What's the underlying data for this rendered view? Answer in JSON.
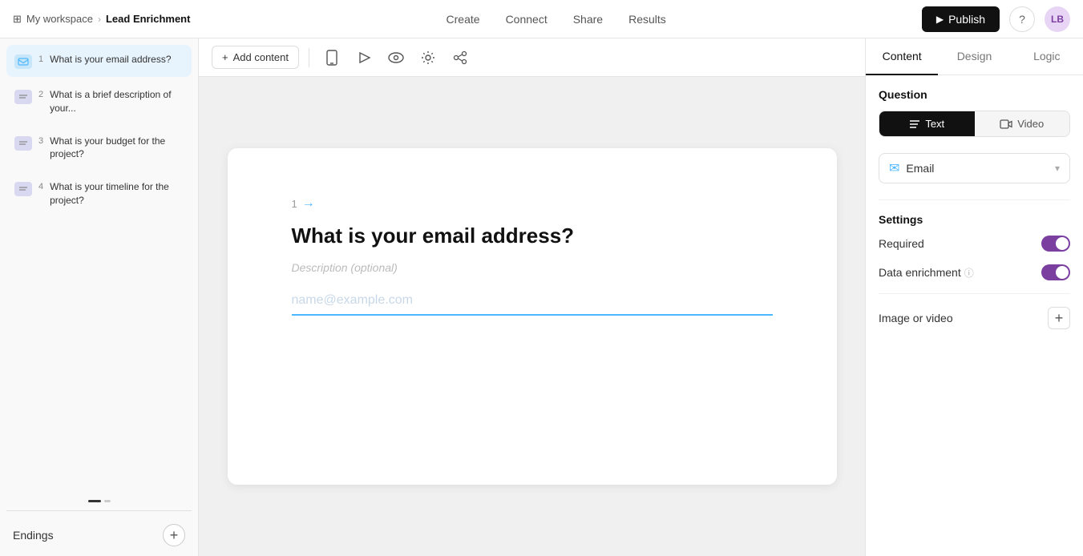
{
  "nav": {
    "workspace": "My workspace",
    "chevron": "›",
    "title": "Lead Enrichment",
    "tabs": [
      "Create",
      "Connect",
      "Share",
      "Results"
    ],
    "publish": "Publish",
    "avatar": "LB"
  },
  "sidebar": {
    "questions": [
      {
        "id": 1,
        "label": "What is your email address?",
        "type": "email",
        "active": true
      },
      {
        "id": 2,
        "label": "What is a brief description of your...",
        "type": "text",
        "active": false
      },
      {
        "id": 3,
        "label": "What is your budget for the project?",
        "type": "text",
        "active": false
      },
      {
        "id": 4,
        "label": "What is your timeline for the project?",
        "type": "text",
        "active": false
      }
    ],
    "endings_label": "Endings",
    "add_label": "+"
  },
  "toolbar": {
    "add_content": "Add content"
  },
  "canvas": {
    "question_number": "1",
    "question_title": "What is your email address?",
    "description_placeholder": "Description (optional)",
    "input_placeholder": "name@example.com"
  },
  "panel": {
    "tabs": [
      "Content",
      "Design",
      "Logic"
    ],
    "active_tab": "Content",
    "question_section": "Question",
    "type_buttons": [
      "Text",
      "Video"
    ],
    "active_type": "Text",
    "field_type": "Email",
    "settings_section": "Settings",
    "required_label": "Required",
    "data_enrichment_label": "Data enrichment",
    "image_video_label": "Image or video",
    "add_media": "+"
  }
}
